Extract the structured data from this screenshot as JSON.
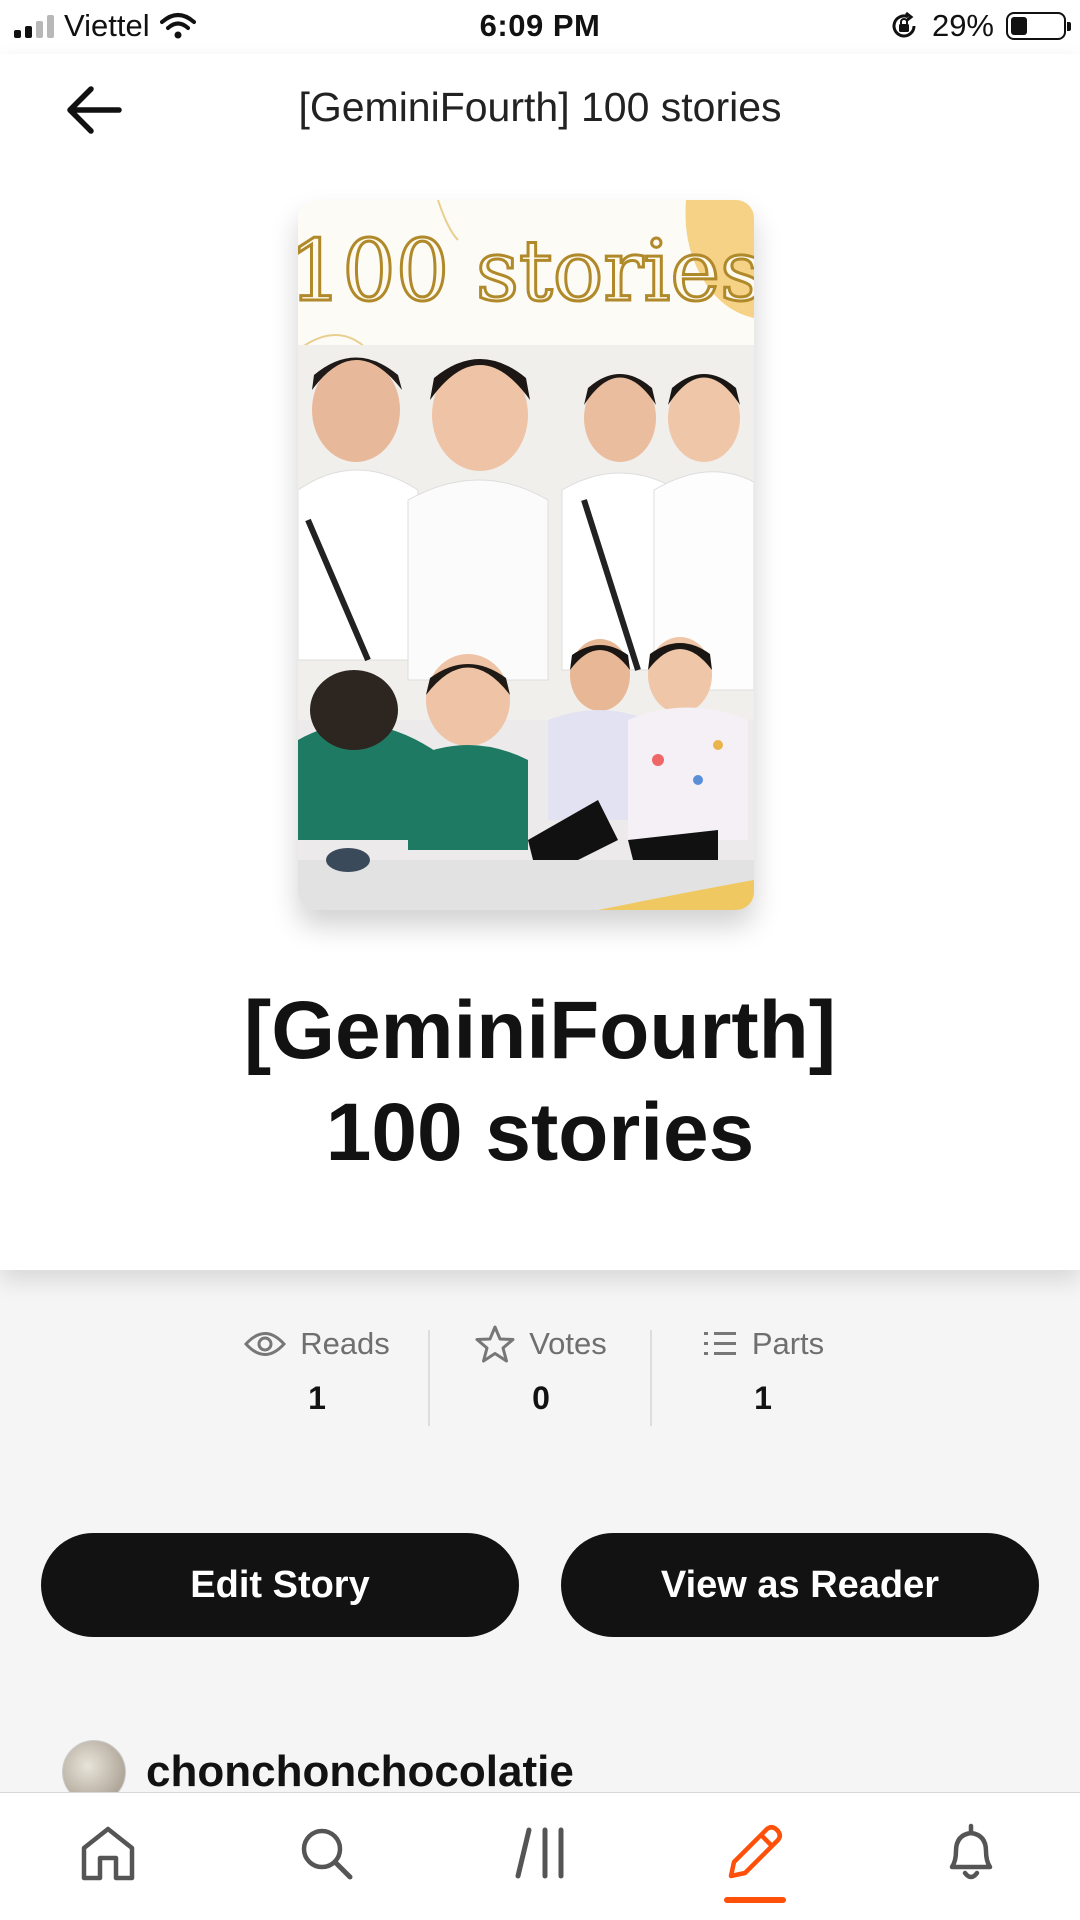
{
  "status_bar": {
    "carrier": "Viettel",
    "time": "6:09 PM",
    "battery_percent": "29%",
    "battery_level": 0.29,
    "icons": [
      "signal-icon",
      "wifi-icon",
      "orientation-lock-icon",
      "battery-icon"
    ]
  },
  "header": {
    "back_icon": "arrow-left-icon",
    "title": "[GeminiFourth] 100 stories"
  },
  "cover": {
    "cover_text": "100 stories"
  },
  "story": {
    "title_line1": "[GeminiFourth]",
    "title_line2": "100 stories"
  },
  "stats": [
    {
      "icon": "eye-icon",
      "label": "Reads",
      "value": "1"
    },
    {
      "icon": "star-icon",
      "label": "Votes",
      "value": "0"
    },
    {
      "icon": "list-icon",
      "label": "Parts",
      "value": "1"
    }
  ],
  "actions": {
    "edit_label": "Edit Story",
    "view_label": "View as Reader"
  },
  "author": {
    "username": "chonchonchocolatie"
  },
  "bottom_nav": {
    "tabs": [
      "home-icon",
      "search-icon",
      "library-icon",
      "write-icon",
      "notifications-icon"
    ],
    "active_tab": "write-icon",
    "accent_color": "#ff500a"
  },
  "colors": {
    "button_bg": "#121212",
    "page_bg": "#f5f5f5"
  }
}
